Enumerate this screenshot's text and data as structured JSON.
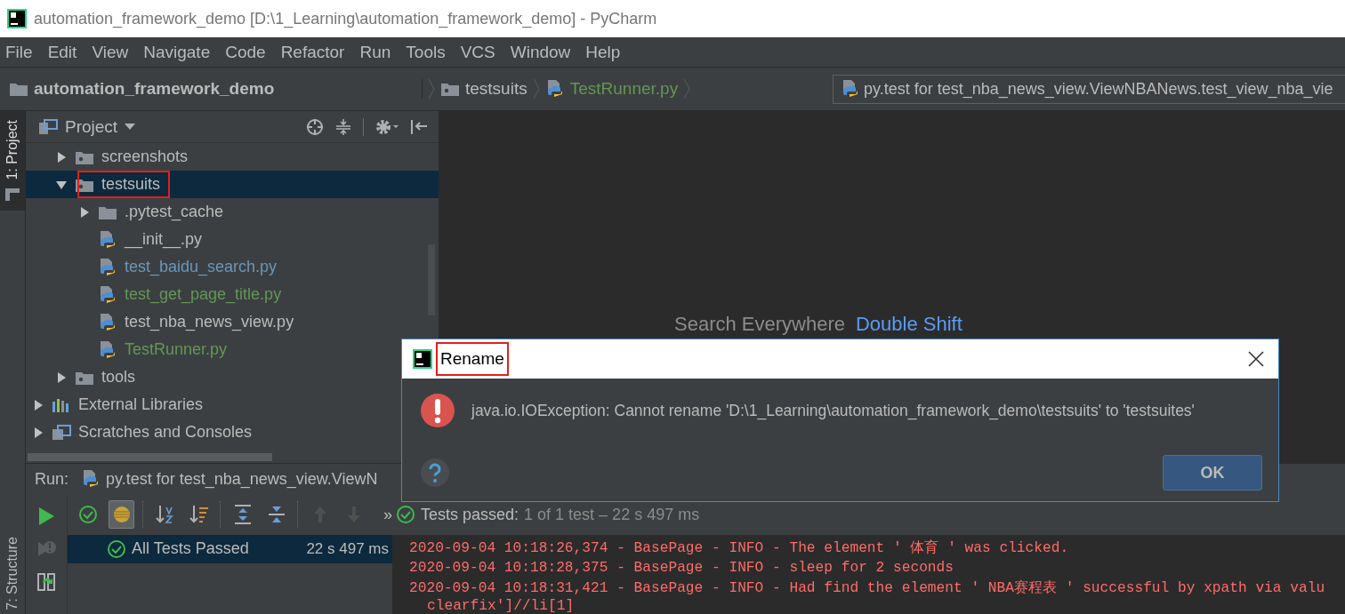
{
  "window": {
    "title": "automation_framework_demo [D:\\1_Learning\\automation_framework_demo] - PyCharm"
  },
  "menu": [
    {
      "label": "File"
    },
    {
      "label": "Edit"
    },
    {
      "label": "View"
    },
    {
      "label": "Navigate"
    },
    {
      "label": "Code"
    },
    {
      "label": "Refactor"
    },
    {
      "label": "Run"
    },
    {
      "label": "Tools"
    },
    {
      "label": "VCS"
    },
    {
      "label": "Window"
    },
    {
      "label": "Help"
    }
  ],
  "breadcrumbs": [
    {
      "label": "automation_framework_demo",
      "kind": "project",
      "color": "#bbbbbb"
    },
    {
      "label": "testsuits",
      "kind": "package",
      "color": "#bbbbbb"
    },
    {
      "label": "TestRunner.py",
      "kind": "python",
      "color": "#629755"
    }
  ],
  "run_config": {
    "label": "py.test for test_nba_news_view.ViewNBANews.test_view_nba_vie"
  },
  "tool_strip": {
    "top": [
      {
        "label": "1: Project",
        "selected": true
      }
    ],
    "bottom": [
      {
        "label": "7: Structure",
        "selected": false
      }
    ]
  },
  "project_panel": {
    "title": "Project",
    "tree": [
      {
        "label": "screenshots",
        "kind": "package",
        "expanded": false,
        "selected": false,
        "highlighted": false,
        "color": "#bbbbbb"
      },
      {
        "label": "testsuits",
        "kind": "package",
        "expanded": true,
        "selected": true,
        "highlighted": true,
        "color": "#bbbbbb",
        "children": [
          {
            "label": ".pytest_cache",
            "kind": "folder",
            "expanded": false,
            "selected": false,
            "highlighted": false,
            "color": "#bbbbbb"
          },
          {
            "label": "__init__.py",
            "kind": "python",
            "selected": false,
            "highlighted": false,
            "color": "#bbbbbb"
          },
          {
            "label": "test_baidu_search.py",
            "kind": "python",
            "selected": false,
            "highlighted": false,
            "color": "#6897bb"
          },
          {
            "label": "test_get_page_title.py",
            "kind": "python",
            "selected": false,
            "highlighted": false,
            "color": "#629755"
          },
          {
            "label": "test_nba_news_view.py",
            "kind": "python",
            "selected": false,
            "highlighted": false,
            "color": "#bbbbbb"
          },
          {
            "label": "TestRunner.py",
            "kind": "python",
            "selected": false,
            "highlighted": false,
            "color": "#629755"
          }
        ]
      },
      {
        "label": "tools",
        "kind": "package",
        "expanded": false,
        "selected": false,
        "highlighted": false,
        "color": "#bbbbbb"
      },
      {
        "label": "External Libraries",
        "kind": "library",
        "expanded": false,
        "selected": false,
        "highlighted": false,
        "color": "#bbbbbb"
      },
      {
        "label": "Scratches and Consoles",
        "kind": "scratches",
        "expanded": false,
        "selected": false,
        "highlighted": false,
        "color": "#bbbbbb"
      }
    ]
  },
  "editor": {
    "hint": "Search Everywhere",
    "shortcut": "Double Shift"
  },
  "run_panel": {
    "label": "Run:",
    "tab": "py.test for test_nba_news_view.ViewN",
    "side_tools": [
      {
        "kind": "rerun",
        "disabled": false
      },
      {
        "kind": "rerun-failed",
        "disabled": true
      },
      {
        "kind": "auto-rerun",
        "disabled": false
      }
    ],
    "tools": [
      {
        "kind": "show-passed",
        "pressed": false,
        "disabled": false
      },
      {
        "kind": "show-ignored",
        "pressed": true,
        "disabled": false
      },
      {
        "kind": "sort-alpha",
        "pressed": false,
        "disabled": false
      },
      {
        "kind": "sort-duration",
        "pressed": false,
        "disabled": false
      },
      {
        "kind": "expand-all",
        "pressed": false,
        "disabled": false
      },
      {
        "kind": "collapse-all",
        "pressed": false,
        "disabled": false
      },
      {
        "kind": "previous",
        "pressed": false,
        "disabled": true
      },
      {
        "kind": "next",
        "pressed": false,
        "disabled": true
      }
    ],
    "more": "»",
    "status": {
      "label": "Tests passed:",
      "detail": "1 of 1 test – 22 s 497 ms"
    },
    "results": [
      {
        "label": "All Tests Passed",
        "time": "22 s 497 ms",
        "selected": true
      }
    ],
    "console": [
      {
        "text": "2020-09-04 10:18:26,374 - BasePage - INFO - The element ' 体育 ' was clicked.",
        "kind": "line"
      },
      {
        "text": "2020-09-04 10:18:28,375 - BasePage - INFO - sleep for 2 seconds",
        "kind": "line"
      },
      {
        "text": "2020-09-04 10:18:31,421 - BasePage - INFO - Had find the element ' NBA赛程表 ' successful by xpath via valu",
        "kind": "line"
      },
      {
        "text": "clearfix']//li[1]",
        "kind": "continuation"
      }
    ]
  },
  "dialog": {
    "title": "Rename",
    "highlighted": true,
    "message": "java.io.IOException: Cannot rename 'D:\\1_Learning\\automation_framework_demo\\testsuits' to 'testsuites'",
    "button": "OK"
  }
}
